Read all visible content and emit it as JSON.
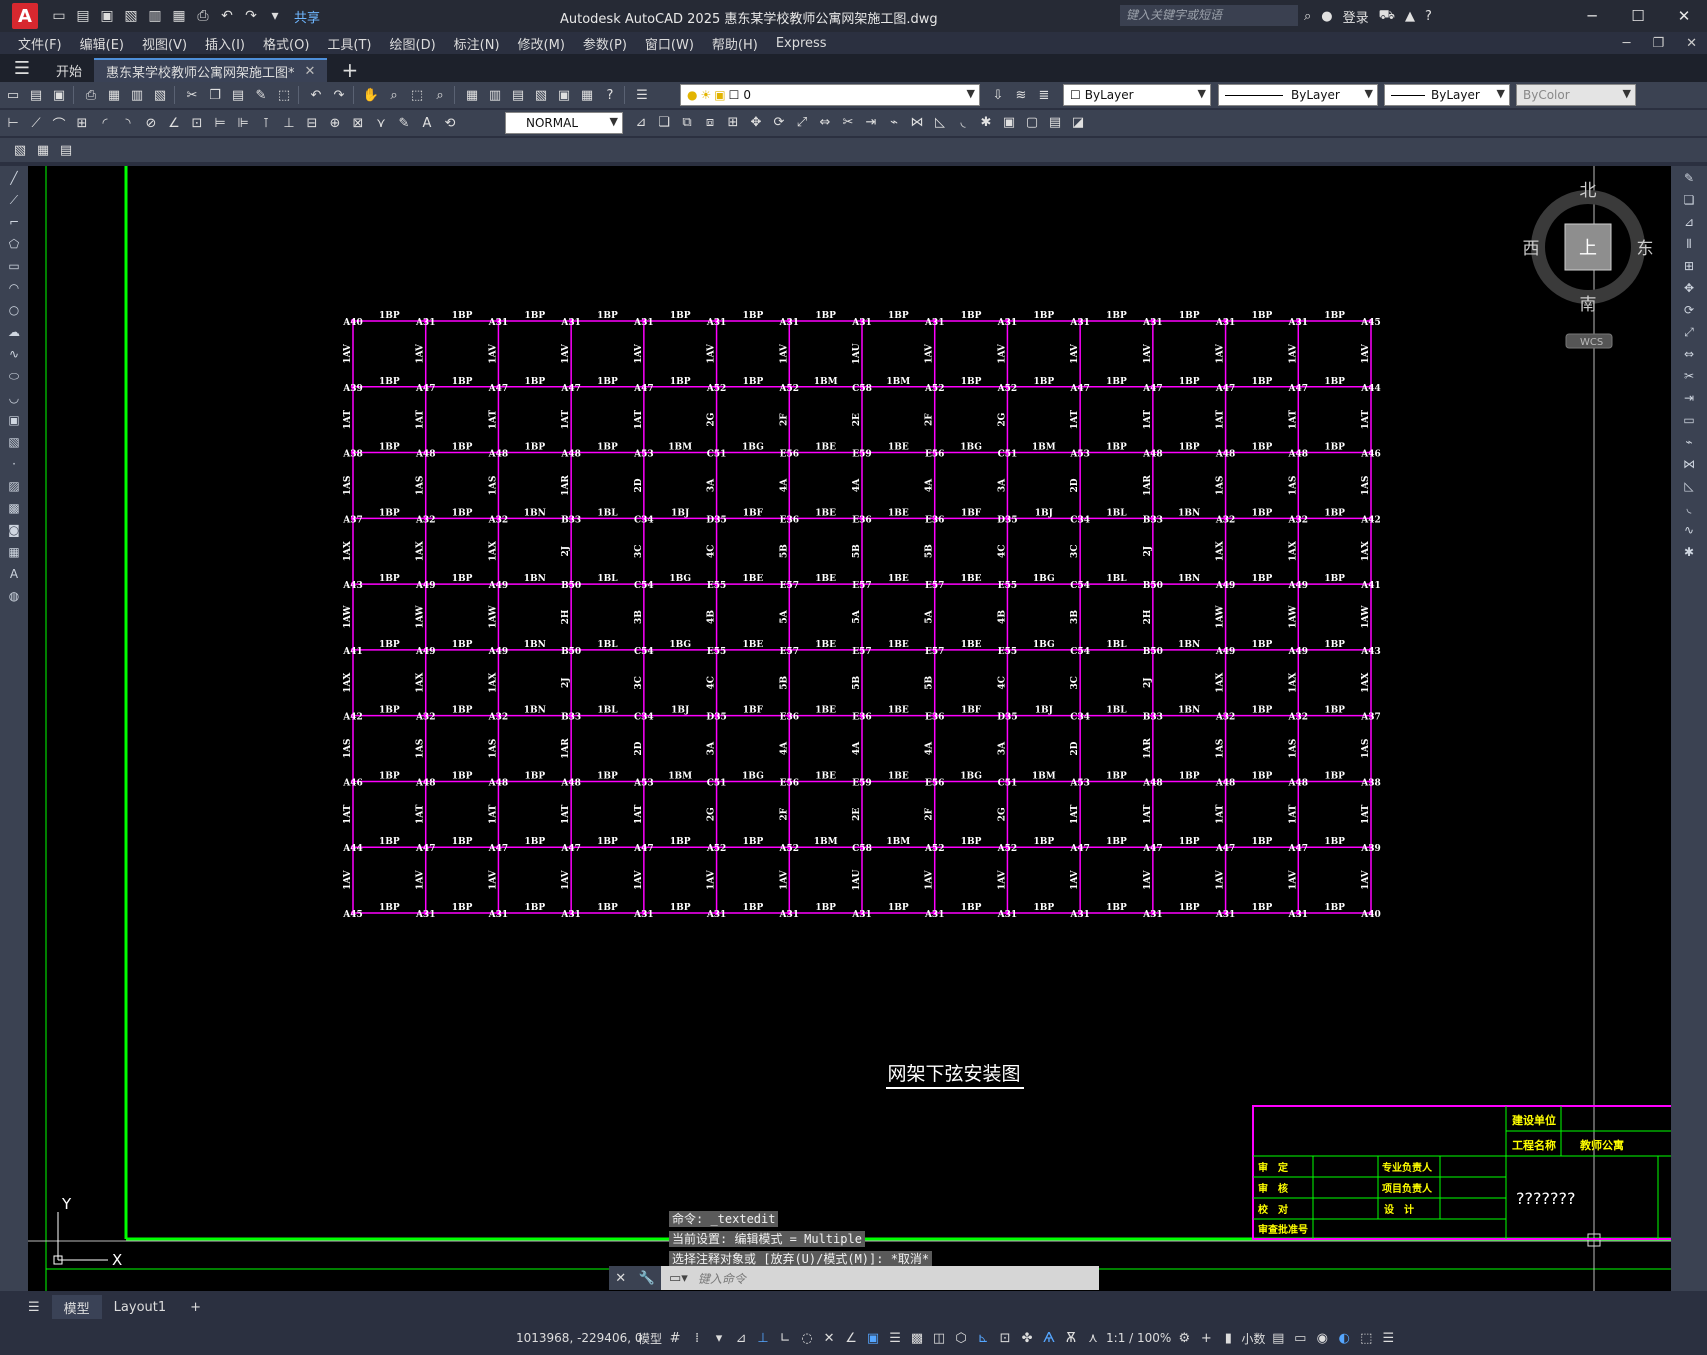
{
  "titlebar": {
    "logo": "A",
    "share": "共享",
    "app_title": "Autodesk AutoCAD 2025    惠东某学校教师公寓网架施工图.dwg",
    "search_placeholder": "键入关键字或短语",
    "login": "登录"
  },
  "menu": [
    "文件(F)",
    "编辑(E)",
    "视图(V)",
    "插入(I)",
    "格式(O)",
    "工具(T)",
    "绘图(D)",
    "标注(N)",
    "修改(M)",
    "参数(P)",
    "窗口(W)",
    "帮助(H)",
    "Express"
  ],
  "tabs": {
    "start": "开始",
    "active": "惠东某学校教师公寓网架施工图*"
  },
  "toolbar": {
    "layer": "0",
    "color": "ByLayer",
    "linetype": "ByLayer",
    "lineweight": "ByLayer",
    "plotstyle": "ByColor",
    "text_style": "NORMAL"
  },
  "viewcube": {
    "north": "北",
    "south": "南",
    "west": "西",
    "east": "东",
    "top": "上",
    "wcs": "WCS"
  },
  "drawing": {
    "title": "网架下弦安装图",
    "grid": {
      "cols": 15,
      "rows": 10,
      "row_nodes": [
        [
          "A40",
          "A31",
          "A31",
          "A31",
          "A31",
          "A31",
          "A31",
          "A31",
          "A31",
          "A31",
          "A31",
          "A31",
          "A31",
          "A31",
          "A45"
        ],
        [
          "A39",
          "A47",
          "A47",
          "A47",
          "A47",
          "A52",
          "A52",
          "C58",
          "A52",
          "A52",
          "A47",
          "A47",
          "A47",
          "A47",
          "A44"
        ],
        [
          "A38",
          "A48",
          "A48",
          "A48",
          "A53",
          "C51",
          "E56",
          "E59",
          "E56",
          "C51",
          "A53",
          "A48",
          "A48",
          "A48",
          "A46"
        ],
        [
          "A37",
          "A32",
          "A32",
          "B33",
          "C34",
          "D35",
          "E36",
          "E36",
          "E36",
          "D35",
          "C34",
          "B33",
          "A32",
          "A32",
          "A42"
        ],
        [
          "A43",
          "A49",
          "A49",
          "B50",
          "C54",
          "E55",
          "E57",
          "E57",
          "E57",
          "E55",
          "C54",
          "B50",
          "A49",
          "A49",
          "A41"
        ],
        [
          "A41",
          "A49",
          "A49",
          "B50",
          "C54",
          "E55",
          "E57",
          "E57",
          "E57",
          "E55",
          "C54",
          "B50",
          "A49",
          "A49",
          "A43"
        ],
        [
          "A42",
          "A32",
          "A32",
          "B33",
          "C34",
          "D35",
          "E36",
          "E36",
          "E36",
          "D35",
          "C34",
          "B33",
          "A32",
          "A32",
          "A37"
        ],
        [
          "A46",
          "A48",
          "A48",
          "A48",
          "A53",
          "C51",
          "E56",
          "E59",
          "E56",
          "C51",
          "A53",
          "A48",
          "A48",
          "A48",
          "A38"
        ],
        [
          "A44",
          "A47",
          "A47",
          "A47",
          "A47",
          "A52",
          "A52",
          "C58",
          "A52",
          "A52",
          "A47",
          "A47",
          "A47",
          "A47",
          "A39"
        ],
        [
          "A45",
          "A31",
          "A31",
          "A31",
          "A31",
          "A31",
          "A31",
          "A31",
          "A31",
          "A31",
          "A31",
          "A31",
          "A31",
          "A31",
          "A40"
        ]
      ],
      "h_members": [
        [
          "1BP",
          "1BP",
          "1BP",
          "1BP",
          "1BP",
          "1BP",
          "1BP",
          "1BP",
          "1BP",
          "1BP",
          "1BP",
          "1BP",
          "1BP",
          "1BP"
        ],
        [
          "1BP",
          "1BP",
          "1BP",
          "1BP",
          "1BP",
          "1BP",
          "1BM",
          "1BM",
          "1BP",
          "1BP",
          "1BP",
          "1BP",
          "1BP",
          "1BP"
        ],
        [
          "1BP",
          "1BP",
          "1BP",
          "1BP",
          "1BM",
          "1BG",
          "1BE",
          "1BE",
          "1BG",
          "1BM",
          "1BP",
          "1BP",
          "1BP",
          "1BP"
        ],
        [
          "1BP",
          "1BP",
          "1BN",
          "1BL",
          "1BJ",
          "1BF",
          "1BE",
          "1BE",
          "1BF",
          "1BJ",
          "1BL",
          "1BN",
          "1BP",
          "1BP"
        ],
        [
          "1BP",
          "1BP",
          "1BN",
          "1BL",
          "1BG",
          "1BE",
          "1BE",
          "1BE",
          "1BE",
          "1BG",
          "1BL",
          "1BN",
          "1BP",
          "1BP"
        ],
        [
          "1BP",
          "1BP",
          "1BN",
          "1BL",
          "1BG",
          "1BE",
          "1BE",
          "1BE",
          "1BE",
          "1BG",
          "1BL",
          "1BN",
          "1BP",
          "1BP"
        ],
        [
          "1BP",
          "1BP",
          "1BN",
          "1BL",
          "1BJ",
          "1BF",
          "1BE",
          "1BE",
          "1BF",
          "1BJ",
          "1BL",
          "1BN",
          "1BP",
          "1BP"
        ],
        [
          "1BP",
          "1BP",
          "1BP",
          "1BP",
          "1BM",
          "1BG",
          "1BE",
          "1BE",
          "1BG",
          "1BM",
          "1BP",
          "1BP",
          "1BP",
          "1BP"
        ],
        [
          "1BP",
          "1BP",
          "1BP",
          "1BP",
          "1BP",
          "1BP",
          "1BM",
          "1BM",
          "1BP",
          "1BP",
          "1BP",
          "1BP",
          "1BP",
          "1BP"
        ],
        [
          "1BP",
          "1BP",
          "1BP",
          "1BP",
          "1BP",
          "1BP",
          "1BP",
          "1BP",
          "1BP",
          "1BP",
          "1BP",
          "1BP",
          "1BP",
          "1BP"
        ]
      ],
      "v_members": [
        [
          "1AV",
          "1AV",
          "1AV",
          "1AV",
          "1AV",
          "1AV",
          "1AV",
          "1AU",
          "1AV",
          "1AV",
          "1AV",
          "1AV",
          "1AV",
          "1AV",
          "1AV"
        ],
        [
          "1AT",
          "1AT",
          "1AT",
          "1AT",
          "1AT",
          "2G",
          "2F",
          "2E",
          "2F",
          "2G",
          "1AT",
          "1AT",
          "1AT",
          "1AT",
          "1AT"
        ],
        [
          "1AS",
          "1AS",
          "1AS",
          "1AR",
          "2D",
          "3A",
          "4A",
          "4A",
          "4A",
          "3A",
          "2D",
          "1AR",
          "1AS",
          "1AS",
          "1AS"
        ],
        [
          "1AX",
          "1AX",
          "1AX",
          "2J",
          "3C",
          "4C",
          "5B",
          "5B",
          "5B",
          "4C",
          "3C",
          "2J",
          "1AX",
          "1AX",
          "1AX"
        ],
        [
          "1AW",
          "1AW",
          "1AW",
          "2H",
          "3B",
          "4B",
          "5A",
          "5A",
          "5A",
          "4B",
          "3B",
          "2H",
          "1AW",
          "1AW",
          "1AW"
        ],
        [
          "1AX",
          "1AX",
          "1AX",
          "2J",
          "3C",
          "4C",
          "5B",
          "5B",
          "5B",
          "4C",
          "3C",
          "2J",
          "1AX",
          "1AX",
          "1AX"
        ],
        [
          "1AS",
          "1AS",
          "1AS",
          "1AR",
          "2D",
          "3A",
          "4A",
          "4A",
          "4A",
          "3A",
          "2D",
          "1AR",
          "1AS",
          "1AS",
          "1AS"
        ],
        [
          "1AT",
          "1AT",
          "1AT",
          "1AT",
          "1AT",
          "2G",
          "2F",
          "2E",
          "2F",
          "2G",
          "1AT",
          "1AT",
          "1AT",
          "1AT",
          "1AT"
        ],
        [
          "1AV",
          "1AV",
          "1AV",
          "1AV",
          "1AV",
          "1AV",
          "1AV",
          "1AU",
          "1AV",
          "1AV",
          "1AV",
          "1AV",
          "1AV",
          "1AV",
          "1AV"
        ]
      ]
    },
    "titleblock": {
      "build_unit": "建设单位",
      "project_name": "工程名称",
      "project_value": "教师公寓",
      "approve": "审　定",
      "review": "审　核",
      "check": "校　对",
      "approval_no": "审查批准号",
      "pro_lead": "专业负责人",
      "proj_lead": "项目负责人",
      "design": "设　计",
      "drawing_name": "???????"
    },
    "ucs_y": "Y",
    "ucs_x": "X"
  },
  "command": {
    "history": [
      "命令: _textedit",
      "当前设置: 编辑模式 = Multiple",
      "选择注释对象或 [放弃(U)/模式(M)]: *取消*"
    ],
    "placeholder": "键入命令"
  },
  "layouts": [
    "模型",
    "Layout1"
  ],
  "status": {
    "coords": "1013968, -229406, 0",
    "space": "模型",
    "scale": "1:1 / 100%",
    "units": "小数"
  },
  "colors": {
    "grid": "#ff00ff",
    "label": "#ffffff",
    "frame": "#00ff00",
    "accent": "#4e8fd9"
  }
}
